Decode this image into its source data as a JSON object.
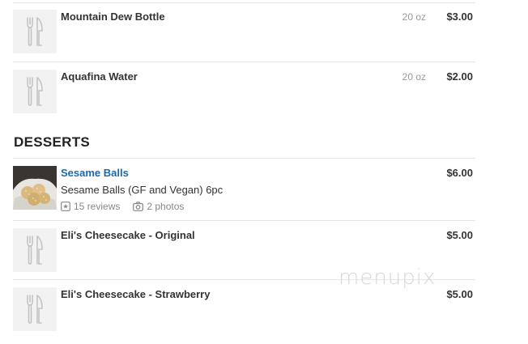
{
  "items_top": [
    {
      "name": "Mountain Dew Bottle",
      "size": "20 oz",
      "price": "$3.00",
      "icon": "utensils-icon"
    },
    {
      "name": "Aquafina Water",
      "size": "20 oz",
      "price": "$2.00",
      "icon": "utensils-icon"
    }
  ],
  "section": {
    "title": "DESSERTS"
  },
  "desserts": [
    {
      "name": "Sesame Balls",
      "description": "Sesame Balls (GF and Vegan) 6pc",
      "reviews": "15 reviews",
      "photos": "2 photos",
      "price": "$6.00",
      "image": "sesame-balls-photo"
    },
    {
      "name": "Eli's Cheesecake - Original",
      "price": "$5.00",
      "icon": "utensils-icon"
    },
    {
      "name": "Eli's Cheesecake - Strawberry",
      "price": "$5.00",
      "icon": "utensils-icon"
    }
  ],
  "watermark": "menupix",
  "colors": {
    "link": "#1a6aa8",
    "placeholder_bg": "#f2f2f2",
    "separator": "#e6e6e6"
  }
}
